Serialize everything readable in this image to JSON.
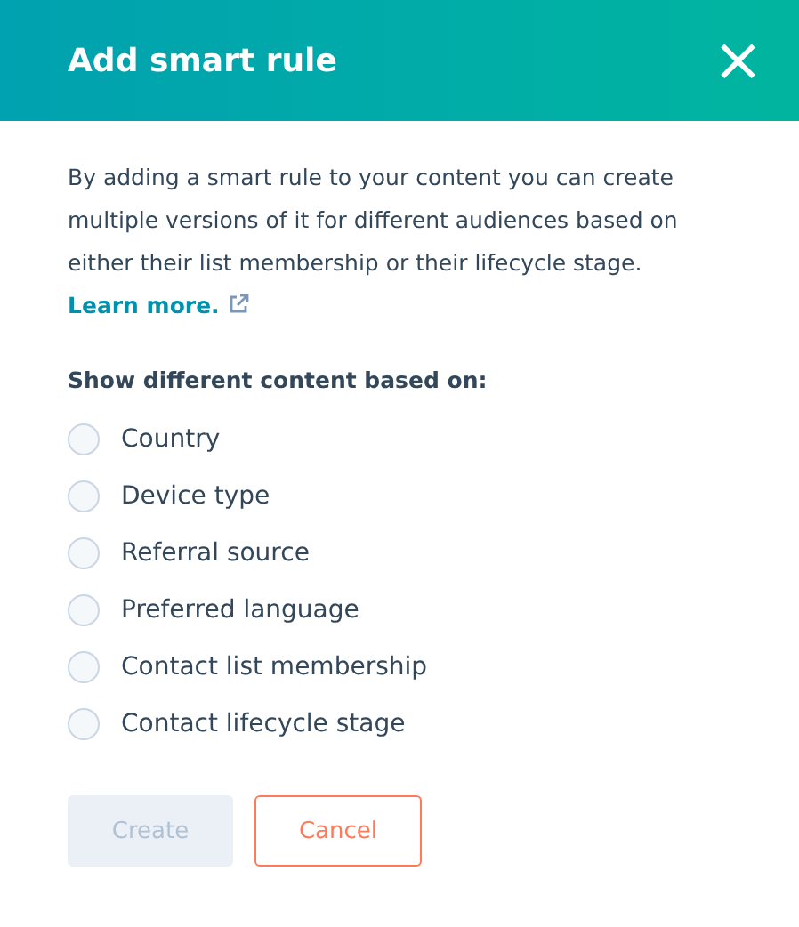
{
  "dialog": {
    "title": "Add smart rule",
    "close": "×"
  },
  "description": {
    "text": "By adding a smart rule to your content you can create multiple versions of it for different audiences based on either their list membership or their lifecycle stage.",
    "link": "Learn more."
  },
  "options_label": "Show different content based on:",
  "options": [
    {
      "label": "Country",
      "selected": false
    },
    {
      "label": "Device type",
      "selected": false
    },
    {
      "label": "Referral source",
      "selected": false
    },
    {
      "label": "Preferred language",
      "selected": false
    },
    {
      "label": "Contact list membership",
      "selected": false
    },
    {
      "label": "Contact lifecycle stage",
      "selected": false
    }
  ],
  "buttons": [
    {
      "label": "Create",
      "kind": "primary",
      "disabled": true
    },
    {
      "label": "Cancel",
      "kind": "secondary",
      "disabled": false
    }
  ]
}
